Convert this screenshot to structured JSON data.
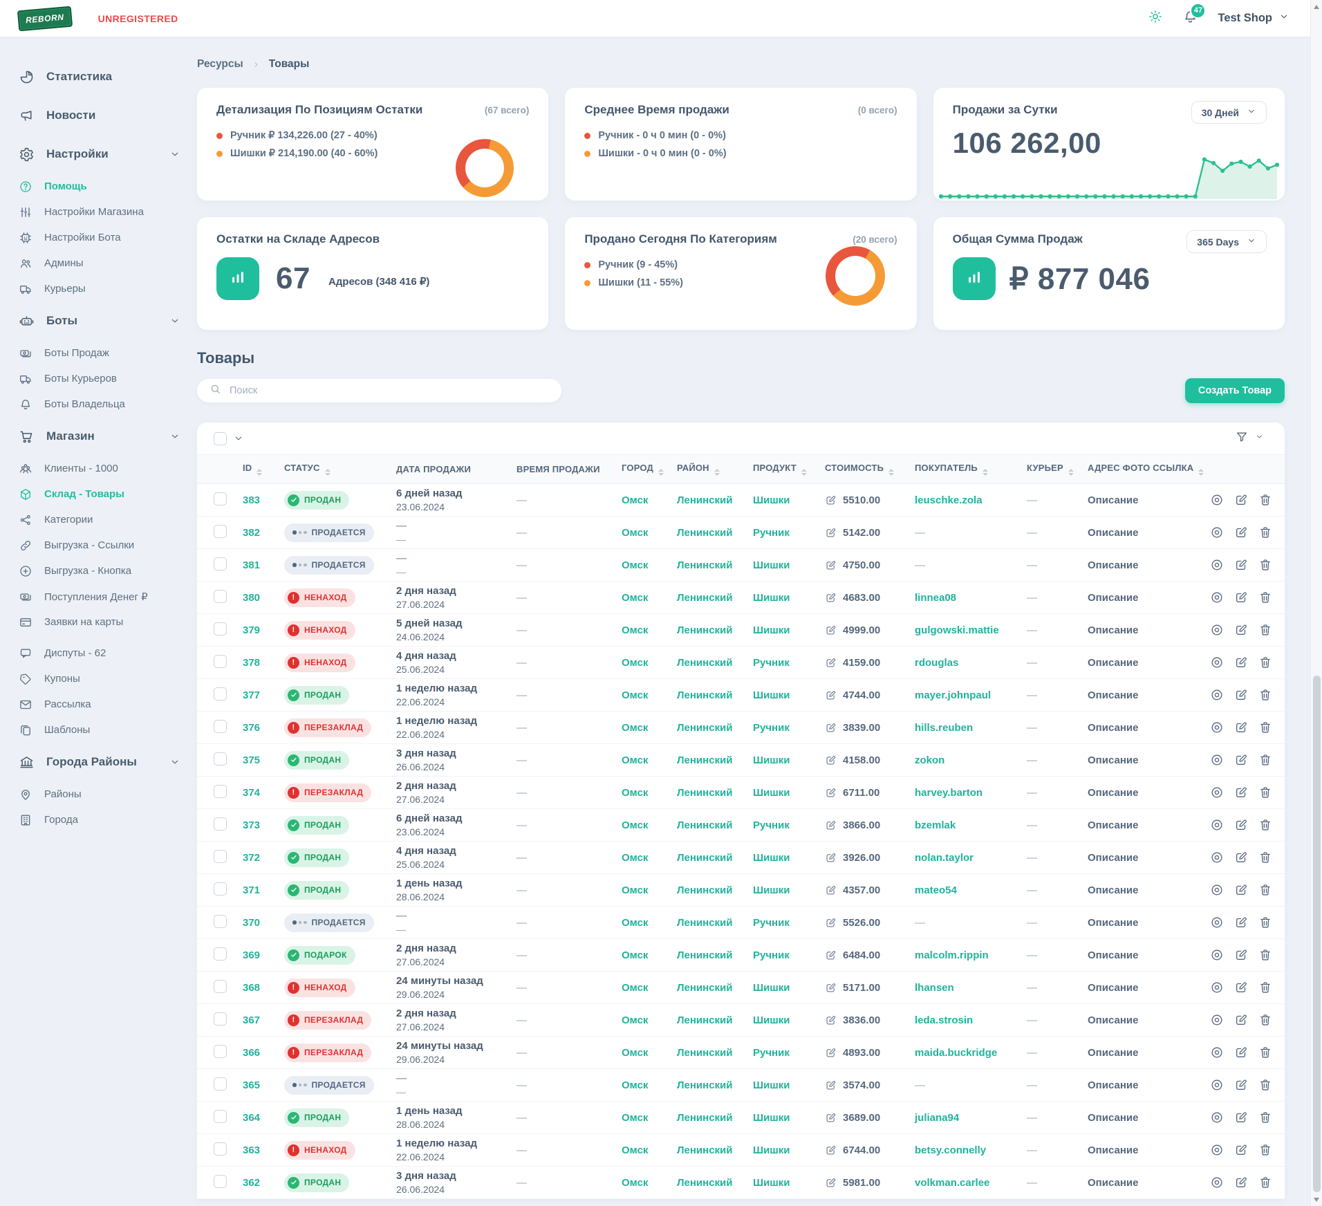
{
  "header": {
    "logo_text": "REBORN",
    "unregistered_label": "UNREGISTERED",
    "notifications_count": "47",
    "shop_name": "Test Shop"
  },
  "breadcrumb": {
    "items": [
      "Ресурсы",
      "Товары"
    ]
  },
  "sidebar": {
    "items": [
      {
        "name": "statistics",
        "label": "Статистика",
        "icon": "stats",
        "type": "root"
      },
      {
        "name": "news",
        "label": "Новости",
        "icon": "news",
        "type": "root"
      },
      {
        "name": "settings",
        "label": "Настройки",
        "icon": "gear",
        "type": "group",
        "chevron": true
      },
      {
        "name": "help",
        "label": "Помощь",
        "icon": "help",
        "type": "child",
        "active": true
      },
      {
        "name": "shop-settings",
        "label": "Настройки Магазина",
        "icon": "sliders",
        "type": "child"
      },
      {
        "name": "bot-settings",
        "label": "Настройки Бота",
        "icon": "chip",
        "type": "child"
      },
      {
        "name": "admins",
        "label": "Админы",
        "icon": "admins",
        "type": "child"
      },
      {
        "name": "couriers",
        "label": "Курьеры",
        "icon": "truck",
        "type": "child"
      },
      {
        "name": "bots",
        "label": "Боты",
        "icon": "robot",
        "type": "group",
        "chevron": true
      },
      {
        "name": "sales-bots",
        "label": "Боты Продаж",
        "icon": "money",
        "type": "child"
      },
      {
        "name": "courier-bots",
        "label": "Боты Курьеров",
        "icon": "truck",
        "type": "child"
      },
      {
        "name": "owner-bots",
        "label": "Боты Владельца",
        "icon": "bell",
        "type": "child"
      },
      {
        "name": "shop",
        "label": "Магазин",
        "icon": "cart",
        "type": "group",
        "chevron": true
      },
      {
        "name": "clients",
        "label": "Клиенты - 1000",
        "icon": "clients",
        "type": "child"
      },
      {
        "name": "warehouse-products",
        "label": "Склад - Товары",
        "icon": "cube",
        "type": "child",
        "active": true
      },
      {
        "name": "categories",
        "label": "Категории",
        "icon": "share",
        "type": "child"
      },
      {
        "name": "export-links",
        "label": "Выгрузка - Ссылки",
        "icon": "link",
        "type": "child"
      },
      {
        "name": "export-button",
        "label": "Выгрузка - Кнопка",
        "icon": "plus",
        "type": "child"
      },
      {
        "name": "money-income",
        "label": "Поступления Денег ₽",
        "icon": "money",
        "type": "child"
      },
      {
        "name": "card-requests",
        "label": "Заявки на карты",
        "icon": "card",
        "type": "child"
      },
      {
        "name": "disputes",
        "label": "Диспуты - 62",
        "icon": "chat",
        "type": "child",
        "spaced": true
      },
      {
        "name": "coupons",
        "label": "Купоны",
        "icon": "tag",
        "type": "child"
      },
      {
        "name": "newsletter",
        "label": "Рассылка",
        "icon": "mail",
        "type": "child"
      },
      {
        "name": "templates",
        "label": "Шаблоны",
        "icon": "copy",
        "type": "child"
      },
      {
        "name": "cities-districts",
        "label": "Города Районы",
        "icon": "bank",
        "type": "group",
        "chevron": true
      },
      {
        "name": "districts",
        "label": "Районы",
        "icon": "pin",
        "type": "child"
      },
      {
        "name": "cities",
        "label": "Города",
        "icon": "building",
        "type": "child"
      }
    ]
  },
  "cards": {
    "stock_detail": {
      "title": "Детализация По Позициям Остатки",
      "note": "(67 всего)",
      "legend": [
        {
          "label": "Ручник ₽ 134,226.00 (27 - 40%)",
          "value": 40,
          "color": "#e8563e"
        },
        {
          "label": "Шишки ₽ 214,190.00 (40 - 60%)",
          "value": 60,
          "color": "#f59b35"
        }
      ]
    },
    "avg_sale_time": {
      "title": "Среднее Время продажи",
      "note": "(0 всего)",
      "legend": [
        {
          "label": "Ручник - 0 ч 0 мин (0 - 0%)",
          "value": 0,
          "color": "#e8563e"
        },
        {
          "label": "Шишки - 0 ч 0 мин (0 - 0%)",
          "value": 0,
          "color": "#f59b35"
        }
      ]
    },
    "daily_sales": {
      "title": "Продажи за Сутки",
      "period": "30 Дней",
      "value": "106 262,00",
      "sparkline": [
        0,
        0,
        0,
        0,
        0,
        0,
        0,
        0,
        0,
        0,
        0,
        0,
        0,
        0,
        0,
        0,
        0,
        0,
        0,
        0,
        0,
        0,
        0,
        0,
        0,
        0,
        0,
        0,
        0,
        62,
        56,
        43,
        55,
        58,
        50,
        60,
        47,
        53
      ]
    },
    "warehouse": {
      "title": "Остатки на Складе Адресов",
      "value": "67",
      "caption": "Адресов (348 416 ₽)"
    },
    "sold_today": {
      "title": "Продано Сегодня По Категориям",
      "note": "(20 всего)",
      "legend": [
        {
          "label": "Ручник (9 - 45%)",
          "value": 45,
          "color": "#e8563e"
        },
        {
          "label": "Шишки (11 - 55%)",
          "value": 55,
          "color": "#f59b35"
        }
      ]
    },
    "total_sales": {
      "title": "Общая Сумма Продаж",
      "period": "365 Days",
      "value": "₽ 877 046"
    }
  },
  "products": {
    "title": "Товары",
    "search_placeholder": "Поиск",
    "create_button": "Создать Товар",
    "table": {
      "columns": [
        {
          "label": "ID",
          "sortable": true
        },
        {
          "label": "СТАТУС",
          "sortable": true
        },
        {
          "label": "ДАТА ПРОДАЖИ",
          "sortable": false
        },
        {
          "label": "ВРЕМЯ ПРОДАЖИ",
          "sortable": false
        },
        {
          "label": "ГОРОД",
          "sortable": true
        },
        {
          "label": "РАЙОН",
          "sortable": true
        },
        {
          "label": "ПРОДУКТ",
          "sortable": true
        },
        {
          "label": "СТОИМОСТЬ",
          "sortable": true
        },
        {
          "label": "ПОКУПАТЕЛЬ",
          "sortable": true
        },
        {
          "label": "КУРЬЕР",
          "sortable": true
        },
        {
          "label": "АДРЕС ФОТО ССЫЛКА",
          "sortable": true
        }
      ],
      "rows": [
        {
          "id": "383",
          "status": "ПРОДАН",
          "status_type": "success",
          "date_rel": "6 дней назад",
          "date": "23.06.2024",
          "time": "—",
          "city": "Омск",
          "district": "Ленинский",
          "product": "Шишки",
          "price": "5510.00",
          "buyer": "leuschke.zola",
          "courier": "—",
          "address": "Описание"
        },
        {
          "id": "382",
          "status": "ПРОДАЕТСЯ",
          "status_type": "selling",
          "date_rel": "—",
          "date": "—",
          "time": "—",
          "city": "Омск",
          "district": "Ленинский",
          "product": "Ручник",
          "price": "5142.00",
          "buyer": "—",
          "courier": "—",
          "address": "Описание"
        },
        {
          "id": "381",
          "status": "ПРОДАЕТСЯ",
          "status_type": "selling",
          "date_rel": "—",
          "date": "—",
          "time": "—",
          "city": "Омск",
          "district": "Ленинский",
          "product": "Шишки",
          "price": "4750.00",
          "buyer": "—",
          "courier": "—",
          "address": "Описание"
        },
        {
          "id": "380",
          "status": "НЕНАХОД",
          "status_type": "danger",
          "date_rel": "2 дня назад",
          "date": "27.06.2024",
          "time": "—",
          "city": "Омск",
          "district": "Ленинский",
          "product": "Шишки",
          "price": "4683.00",
          "buyer": "linnea08",
          "courier": "—",
          "address": "Описание"
        },
        {
          "id": "379",
          "status": "НЕНАХОД",
          "status_type": "danger",
          "date_rel": "5 дней назад",
          "date": "24.06.2024",
          "time": "—",
          "city": "Омск",
          "district": "Ленинский",
          "product": "Шишки",
          "price": "4999.00",
          "buyer": "gulgowski.mattie",
          "courier": "—",
          "address": "Описание"
        },
        {
          "id": "378",
          "status": "НЕНАХОД",
          "status_type": "danger",
          "date_rel": "4 дня назад",
          "date": "25.06.2024",
          "time": "—",
          "city": "Омск",
          "district": "Ленинский",
          "product": "Ручник",
          "price": "4159.00",
          "buyer": "rdouglas",
          "courier": "—",
          "address": "Описание"
        },
        {
          "id": "377",
          "status": "ПРОДАН",
          "status_type": "success",
          "date_rel": "1 неделю назад",
          "date": "22.06.2024",
          "time": "—",
          "city": "Омск",
          "district": "Ленинский",
          "product": "Шишки",
          "price": "4744.00",
          "buyer": "mayer.johnpaul",
          "courier": "—",
          "address": "Описание"
        },
        {
          "id": "376",
          "status": "ПЕРЕЗАКЛАД",
          "status_type": "danger",
          "date_rel": "1 неделю назад",
          "date": "22.06.2024",
          "time": "—",
          "city": "Омск",
          "district": "Ленинский",
          "product": "Ручник",
          "price": "3839.00",
          "buyer": "hills.reuben",
          "courier": "—",
          "address": "Описание"
        },
        {
          "id": "375",
          "status": "ПРОДАН",
          "status_type": "success",
          "date_rel": "3 дня назад",
          "date": "26.06.2024",
          "time": "—",
          "city": "Омск",
          "district": "Ленинский",
          "product": "Шишки",
          "price": "4158.00",
          "buyer": "zokon",
          "courier": "—",
          "address": "Описание"
        },
        {
          "id": "374",
          "status": "ПЕРЕЗАКЛАД",
          "status_type": "danger",
          "date_rel": "2 дня назад",
          "date": "27.06.2024",
          "time": "—",
          "city": "Омск",
          "district": "Ленинский",
          "product": "Шишки",
          "price": "6711.00",
          "buyer": "harvey.barton",
          "courier": "—",
          "address": "Описание"
        },
        {
          "id": "373",
          "status": "ПРОДАН",
          "status_type": "success",
          "date_rel": "6 дней назад",
          "date": "23.06.2024",
          "time": "—",
          "city": "Омск",
          "district": "Ленинский",
          "product": "Ручник",
          "price": "3866.00",
          "buyer": "bzemlak",
          "courier": "—",
          "address": "Описание"
        },
        {
          "id": "372",
          "status": "ПРОДАН",
          "status_type": "success",
          "date_rel": "4 дня назад",
          "date": "25.06.2024",
          "time": "—",
          "city": "Омск",
          "district": "Ленинский",
          "product": "Шишки",
          "price": "3926.00",
          "buyer": "nolan.taylor",
          "courier": "—",
          "address": "Описание"
        },
        {
          "id": "371",
          "status": "ПРОДАН",
          "status_type": "success",
          "date_rel": "1 день назад",
          "date": "28.06.2024",
          "time": "—",
          "city": "Омск",
          "district": "Ленинский",
          "product": "Шишки",
          "price": "4357.00",
          "buyer": "mateo54",
          "courier": "—",
          "address": "Описание"
        },
        {
          "id": "370",
          "status": "ПРОДАЕТСЯ",
          "status_type": "selling",
          "date_rel": "—",
          "date": "—",
          "time": "—",
          "city": "Омск",
          "district": "Ленинский",
          "product": "Ручник",
          "price": "5526.00",
          "buyer": "—",
          "courier": "—",
          "address": "Описание"
        },
        {
          "id": "369",
          "status": "ПОДАРОК",
          "status_type": "success",
          "date_rel": "2 дня назад",
          "date": "27.06.2024",
          "time": "—",
          "city": "Омск",
          "district": "Ленинский",
          "product": "Ручник",
          "price": "6484.00",
          "buyer": "malcolm.rippin",
          "courier": "—",
          "address": "Описание"
        },
        {
          "id": "368",
          "status": "НЕНАХОД",
          "status_type": "danger",
          "date_rel": "24 минуты назад",
          "date": "29.06.2024",
          "time": "—",
          "city": "Омск",
          "district": "Ленинский",
          "product": "Шишки",
          "price": "5171.00",
          "buyer": "lhansen",
          "courier": "—",
          "address": "Описание"
        },
        {
          "id": "367",
          "status": "ПЕРЕЗАКЛАД",
          "status_type": "danger",
          "date_rel": "2 дня назад",
          "date": "27.06.2024",
          "time": "—",
          "city": "Омск",
          "district": "Ленинский",
          "product": "Шишки",
          "price": "3836.00",
          "buyer": "leda.strosin",
          "courier": "—",
          "address": "Описание"
        },
        {
          "id": "366",
          "status": "ПЕРЕЗАКЛАД",
          "status_type": "danger",
          "date_rel": "24 минуты назад",
          "date": "29.06.2024",
          "time": "—",
          "city": "Омск",
          "district": "Ленинский",
          "product": "Ручник",
          "price": "4893.00",
          "buyer": "maida.buckridge",
          "courier": "—",
          "address": "Описание"
        },
        {
          "id": "365",
          "status": "ПРОДАЕТСЯ",
          "status_type": "selling",
          "date_rel": "—",
          "date": "—",
          "time": "—",
          "city": "Омск",
          "district": "Ленинский",
          "product": "Шишки",
          "price": "3574.00",
          "buyer": "—",
          "courier": "—",
          "address": "Описание"
        },
        {
          "id": "364",
          "status": "ПРОДАН",
          "status_type": "success",
          "date_rel": "1 день назад",
          "date": "28.06.2024",
          "time": "—",
          "city": "Омск",
          "district": "Ленинский",
          "product": "Шишки",
          "price": "3689.00",
          "buyer": "juliana94",
          "courier": "—",
          "address": "Описание"
        },
        {
          "id": "363",
          "status": "НЕНАХОД",
          "status_type": "danger",
          "date_rel": "1 неделю назад",
          "date": "22.06.2024",
          "time": "—",
          "city": "Омск",
          "district": "Ленинский",
          "product": "Шишки",
          "price": "6744.00",
          "buyer": "betsy.connelly",
          "courier": "—",
          "address": "Описание"
        },
        {
          "id": "362",
          "status": "ПРОДАН",
          "status_type": "success",
          "date_rel": "3 дня назад",
          "date": "26.06.2024",
          "time": "—",
          "city": "Омск",
          "district": "Ленинский",
          "product": "Шишки",
          "price": "5981.00",
          "buyer": "volkman.carlee",
          "courier": "—",
          "address": "Описание"
        }
      ]
    }
  },
  "colors": {
    "accent": "#1fbf9e",
    "link": "#21b39b",
    "danger": "#e03131",
    "success": "#2bb673",
    "red_slice": "#e8563e",
    "orange_slice": "#f59b35",
    "sparkline_line": "#2cc092",
    "sparkline_fill": "#ddf3ea"
  }
}
